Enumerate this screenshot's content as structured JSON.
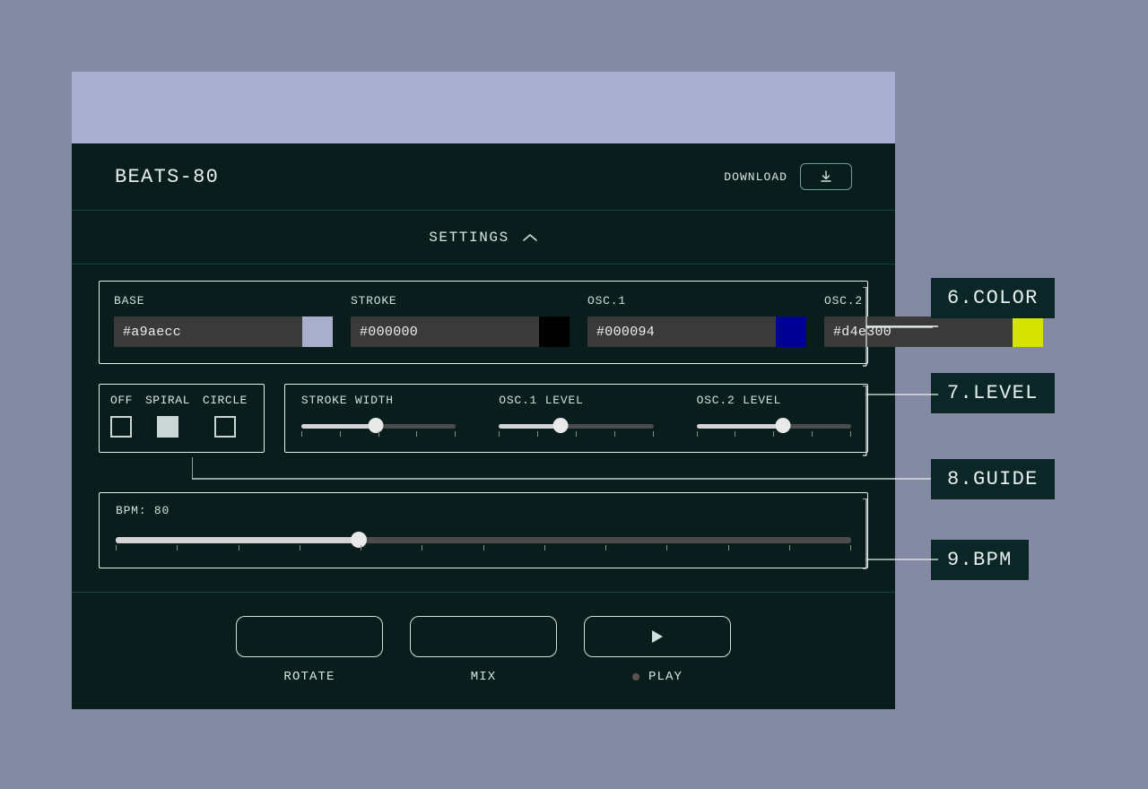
{
  "header": {
    "title": "BEATS-80",
    "download_label": "DOWNLOAD",
    "settings_label": "SETTINGS"
  },
  "colors": {
    "base": {
      "label": "BASE",
      "value": "#a9aecc",
      "swatch": "#a9aecc"
    },
    "stroke": {
      "label": "STROKE",
      "value": "#000000",
      "swatch": "#000000"
    },
    "osc1": {
      "label": "OSC.1",
      "value": "#000094",
      "swatch": "#000094"
    },
    "osc2": {
      "label": "OSC.2",
      "value": "#d4e300",
      "swatch": "#d4e300"
    }
  },
  "guide": {
    "options": [
      {
        "label": "OFF",
        "on": false
      },
      {
        "label": "SPIRAL",
        "on": true
      },
      {
        "label": "CIRCLE",
        "on": false
      }
    ]
  },
  "levels": {
    "stroke_width": {
      "label": "STROKE WIDTH",
      "value": 48,
      "ticks": 5
    },
    "osc1": {
      "label": "OSC.1 LEVEL",
      "value": 40,
      "ticks": 5
    },
    "osc2": {
      "label": "OSC.2 LEVEL",
      "value": 56,
      "ticks": 5
    }
  },
  "bpm": {
    "prefix": "BPM: ",
    "value": 80,
    "percent": 33,
    "ticks": 13
  },
  "actions": {
    "rotate": "ROTATE",
    "mix": "MIX",
    "play": "PLAY"
  },
  "annotations": {
    "color": "6.COLOR",
    "level": "7.LEVEL",
    "guide": "8.GUIDE",
    "bpm": "9.BPM"
  }
}
